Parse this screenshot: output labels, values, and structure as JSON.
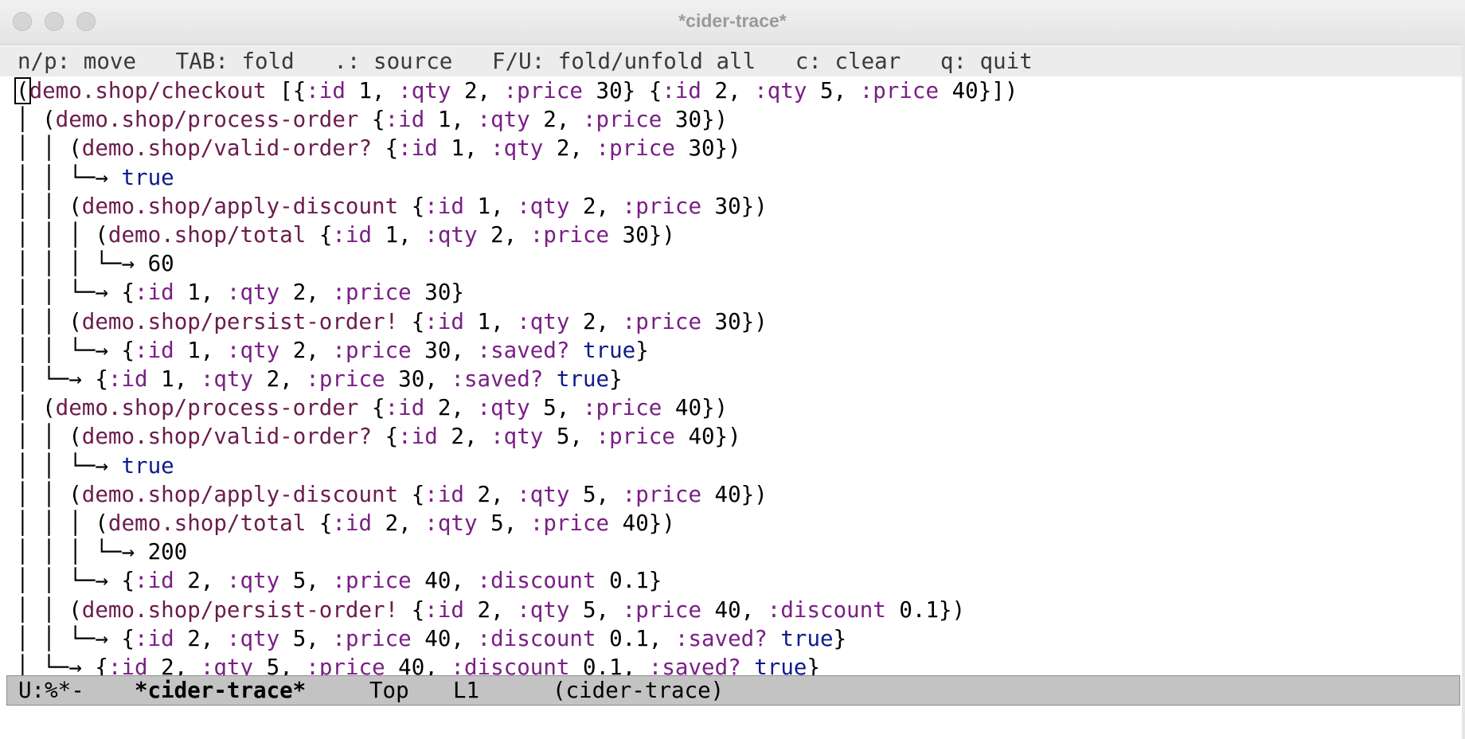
{
  "window": {
    "title": "*cider-trace*"
  },
  "header_line": "n/p: move   TAB: fold   .: source   F/U: fold/unfold all   c: clear   q: quit",
  "trace_lines": [
    "(demo.shop/checkout [{:id 1, :qty 2, :price 30} {:id 2, :qty 5, :price 40}])",
    "│ (demo.shop/process-order {:id 1, :qty 2, :price 30})",
    "│ │ (demo.shop/valid-order? {:id 1, :qty 2, :price 30})",
    "│ │ └─→ true",
    "│ │ (demo.shop/apply-discount {:id 1, :qty 2, :price 30})",
    "│ │ │ (demo.shop/total {:id 1, :qty 2, :price 30})",
    "│ │ │ └─→ 60",
    "│ │ └─→ {:id 1, :qty 2, :price 30}",
    "│ │ (demo.shop/persist-order! {:id 1, :qty 2, :price 30})",
    "│ │ └─→ {:id 1, :qty 2, :price 30, :saved? true}",
    "│ └─→ {:id 1, :qty 2, :price 30, :saved? true}",
    "│ (demo.shop/process-order {:id 2, :qty 5, :price 40})",
    "│ │ (demo.shop/valid-order? {:id 2, :qty 5, :price 40})",
    "│ │ └─→ true",
    "│ │ (demo.shop/apply-discount {:id 2, :qty 5, :price 40})",
    "│ │ │ (demo.shop/total {:id 2, :qty 5, :price 40})",
    "│ │ │ └─→ 200",
    "│ │ └─→ {:id 2, :qty 5, :price 40, :discount 0.1}",
    "│ │ (demo.shop/persist-order! {:id 2, :qty 5, :price 40, :discount 0.1})",
    "│ │ └─→ {:id 2, :qty 5, :price 40, :discount 0.1, :saved? true}",
    "│ └─→ {:id 2, :qty 5, :price 40, :discount 0.1, :saved? true}"
  ],
  "modeline": {
    "status": "U:%*-",
    "buffer": "*cider-trace*",
    "position": "Top",
    "line": "L1",
    "mode": "(cider-trace)"
  },
  "colors": {
    "function": "#6b1c4c",
    "keyword": "#7a1f86",
    "boolean": "#0d1b8a",
    "modeline_bg": "#c3c3c3"
  }
}
